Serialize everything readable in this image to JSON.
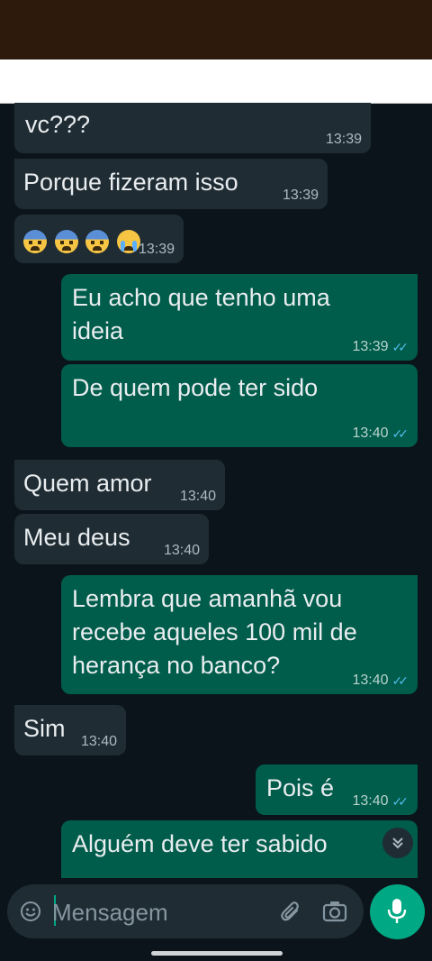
{
  "messages": [
    {
      "type": "in",
      "text": "vc???",
      "time": "13:39"
    },
    {
      "type": "in",
      "text": "Porque fizeram isso",
      "time": "13:39"
    },
    {
      "type": "in",
      "text": "😰😰😰😭",
      "time": "13:39"
    },
    {
      "type": "out",
      "text": "Eu acho que tenho uma ideia",
      "time": "13:39",
      "status": "read"
    },
    {
      "type": "out",
      "text": "De quem pode ter sido",
      "time": "13:40",
      "status": "read"
    },
    {
      "type": "in",
      "text": "Quem amor",
      "time": "13:40"
    },
    {
      "type": "in",
      "text": "Meu deus",
      "time": "13:40"
    },
    {
      "type": "out",
      "text": "Lembra que amanhã vou recebe aqueles 100 mil de herança no banco?",
      "time": "13:40",
      "status": "read"
    },
    {
      "type": "in",
      "text": "Sim",
      "time": "13:40"
    },
    {
      "type": "out",
      "text": "Pois é",
      "time": "13:40",
      "status": "read"
    },
    {
      "type": "out",
      "text": "Alguém deve ter sabido",
      "time": "",
      "status": ""
    }
  ],
  "input": {
    "placeholder": "Mensagem"
  },
  "icons": {
    "emoji": "emoji-icon",
    "attach": "paperclip-icon",
    "camera": "camera-icon",
    "mic": "mic-icon",
    "scroll": "chevron-double-down-icon"
  },
  "colors": {
    "background": "#0b141a",
    "incoming": "#1f2c34",
    "outgoing": "#005c4b",
    "accent": "#00a884",
    "read_ticks": "#53bdeb"
  }
}
